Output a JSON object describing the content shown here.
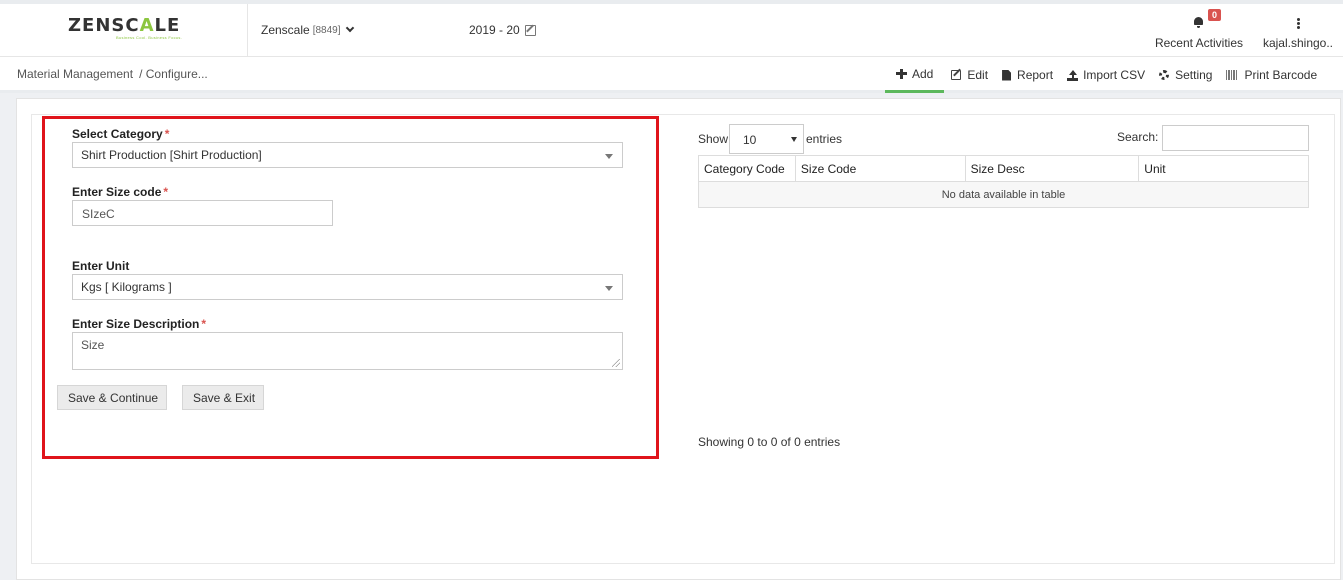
{
  "header": {
    "logo": {
      "part1": "ZENSC",
      "part2": "A",
      "part3": "LE",
      "tagline": "Business Cool. Business Focus."
    },
    "company": {
      "name": "Zenscale",
      "code": "[8849]"
    },
    "fiscal_year": "2019 - 20",
    "activities": {
      "badge": "0",
      "label": "Recent Activities"
    },
    "user": {
      "label": "kajal.shingo.."
    }
  },
  "breadcrumb": {
    "root": "Material Management",
    "current": "/ Configure..."
  },
  "toolbar": {
    "add": "Add",
    "edit": "Edit",
    "report": "Report",
    "import": "Import CSV",
    "setting": "Setting",
    "print": "Print Barcode"
  },
  "form": {
    "category": {
      "label": "Select Category",
      "value": "Shirt Production [Shirt Production]"
    },
    "size_code": {
      "label": "Enter Size code",
      "value": "SIzeC"
    },
    "unit": {
      "label": "Enter Unit",
      "value": "Kgs [ Kilograms ]"
    },
    "size_desc": {
      "label": "Enter Size Description",
      "value": "Size"
    },
    "required_mark": "*",
    "save_continue": "Save & Continue",
    "save_exit": "Save & Exit"
  },
  "table": {
    "show_label": "Show",
    "page_length": "10",
    "entries_label": "entries",
    "search_label": "Search:",
    "search_value": "",
    "columns": [
      "Category Code",
      "Size Code",
      "Size Desc",
      "Unit"
    ],
    "empty_message": "No data available in table",
    "info": "Showing 0 to 0 of 0 entries"
  },
  "colors": {
    "accent": "#8cc63f",
    "highlight_border": "#e0141b",
    "active_tab": "#5cb85c",
    "badge": "#d9534f"
  }
}
